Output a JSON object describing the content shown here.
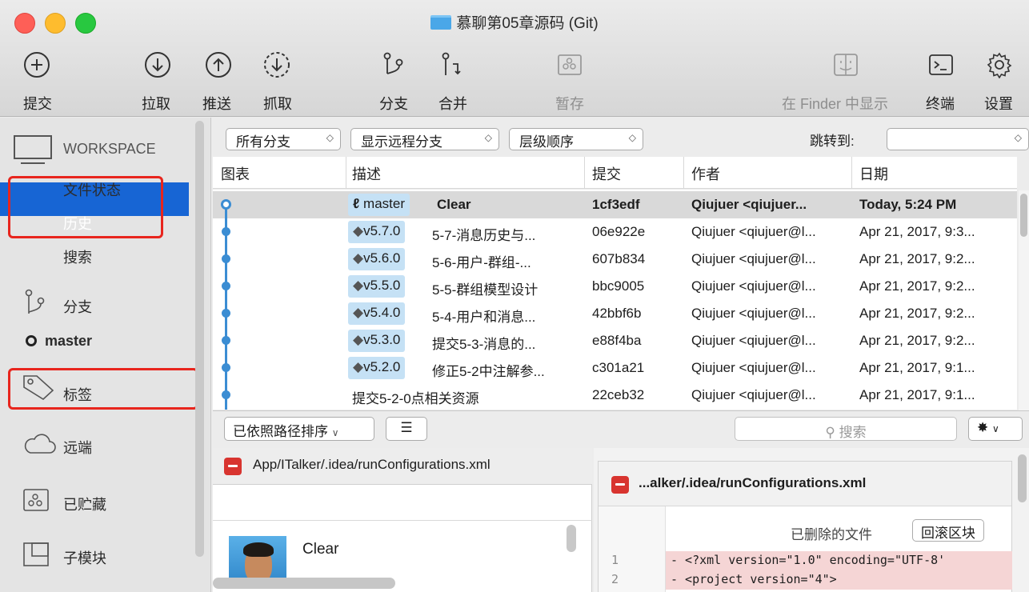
{
  "window": {
    "title": "慕聊第05章源码 (Git)"
  },
  "toolbar": {
    "commit": "提交",
    "pull": "拉取",
    "push": "推送",
    "fetch": "抓取",
    "branch": "分支",
    "merge": "合并",
    "stash": "暂存",
    "finder": "在 Finder 中显示",
    "terminal": "终端",
    "settings": "设置"
  },
  "sidebar": {
    "workspace": "WORKSPACE",
    "file_status": "文件状态",
    "history": "历史",
    "search": "搜索",
    "branches": "分支",
    "branch_master": "master",
    "tags": "标签",
    "remotes": "远端",
    "stashes": "已贮藏",
    "submodules": "子模块"
  },
  "filters": {
    "branches": "所有分支",
    "remote": "显示远程分支",
    "order": "层级顺序",
    "jump_to": "跳转到:"
  },
  "columns": {
    "graph": "图表",
    "description": "描述",
    "commit": "提交",
    "author": "作者",
    "date": "日期"
  },
  "commits": [
    {
      "ref": "master",
      "desc": "Clear",
      "hash": "1cf3edf",
      "author": "Qiujuer <qiujuer...",
      "date": "Today, 5:24 PM"
    },
    {
      "ref": "v5.7.0",
      "desc": "5-7-消息历史与...",
      "hash": "06e922e",
      "author": "Qiujuer <qiujuer@l...",
      "date": "Apr 21, 2017, 9:3..."
    },
    {
      "ref": "v5.6.0",
      "desc": "5-6-用户-群组-...",
      "hash": "607b834",
      "author": "Qiujuer <qiujuer@l...",
      "date": "Apr 21, 2017, 9:2..."
    },
    {
      "ref": "v5.5.0",
      "desc": "5-5-群组模型设计",
      "hash": "bbc9005",
      "author": "Qiujuer <qiujuer@l...",
      "date": "Apr 21, 2017, 9:2..."
    },
    {
      "ref": "v5.4.0",
      "desc": "5-4-用户和消息...",
      "hash": "42bbf6b",
      "author": "Qiujuer <qiujuer@l...",
      "date": "Apr 21, 2017, 9:2..."
    },
    {
      "ref": "v5.3.0",
      "desc": "提交5-3-消息的...",
      "hash": "e88f4ba",
      "author": "Qiujuer <qiujuer@l...",
      "date": "Apr 21, 2017, 9:2..."
    },
    {
      "ref": "v5.2.0",
      "desc": "修正5-2中注解参...",
      "hash": "c301a21",
      "author": "Qiujuer <qiujuer@l...",
      "date": "Apr 21, 2017, 9:1..."
    },
    {
      "ref": "",
      "desc": "提交5-2-0点相关资源",
      "hash": "22ceb32",
      "author": "Qiujuer <qiujuer@l...",
      "date": "Apr 21, 2017, 9:1..."
    }
  ],
  "bottom": {
    "sort": "已依照路径排序",
    "search_placeholder": "搜索",
    "file": "App/ITalker/.idea/runConfigurations.xml",
    "commit_message": "Clear",
    "diff_title": "...alker/.idea/runConfigurations.xml",
    "deleted_file": "已删除的文件",
    "revert_hunk": "回滚区块",
    "diff_lines": [
      {
        "num": "1",
        "text": "- <?xml version=\"1.0\" encoding=\"UTF-8'"
      },
      {
        "num": "2",
        "text": "- <project version=\"4\">"
      }
    ]
  },
  "colors": {
    "selection": "#1765d4",
    "highlight": "#e8251d",
    "graph": "#3b8dd3",
    "tag": "#c5e1f5",
    "deleted": "#f5d5d5"
  }
}
